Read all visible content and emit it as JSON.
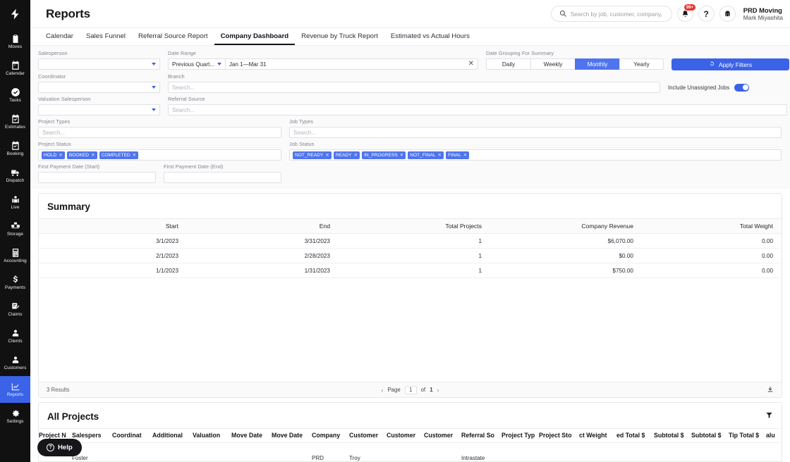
{
  "sidebar": {
    "logo_icon": "bolt-logo-icon",
    "items": [
      {
        "label": "Moves",
        "icon": "clipboard-icon",
        "active": false
      },
      {
        "label": "Calendar",
        "icon": "calendar-icon",
        "active": false
      },
      {
        "label": "Tasks",
        "icon": "check-circle-icon",
        "active": false
      },
      {
        "label": "Estimates",
        "icon": "calendar-check-icon",
        "active": false
      },
      {
        "label": "Booking",
        "icon": "calendar-book-icon",
        "active": false
      },
      {
        "label": "Dispatch",
        "icon": "truck-icon",
        "active": false
      },
      {
        "label": "Live",
        "icon": "live-person-icon",
        "active": false
      },
      {
        "label": "Storage",
        "icon": "boxes-icon",
        "active": false
      },
      {
        "label": "Accounting",
        "icon": "calculator-icon",
        "active": false
      },
      {
        "label": "Payments",
        "icon": "dollar-icon",
        "active": false
      },
      {
        "label": "Claims",
        "icon": "claim-doc-icon",
        "active": false
      },
      {
        "label": "Clients",
        "icon": "person-icon",
        "active": false
      },
      {
        "label": "Customers",
        "icon": "person-icon",
        "active": false
      },
      {
        "label": "Reports",
        "icon": "chart-icon",
        "active": true
      },
      {
        "label": "Settings",
        "icon": "gear-icon",
        "active": false
      }
    ]
  },
  "header": {
    "title": "Reports",
    "search": {
      "placeholder": "Search by job, customer, company, etc...",
      "icon": "search-icon"
    },
    "notifications": {
      "icon": "bell-icon",
      "badge": "99+"
    },
    "help": {
      "icon": "question-mark-icon",
      "label": "?"
    },
    "account": {
      "icon": "avatar-icon"
    },
    "user": {
      "org": "PRD Moving",
      "name": "Mark Miyashita"
    }
  },
  "tabs": [
    {
      "label": "Calendar",
      "active": false
    },
    {
      "label": "Sales Funnel",
      "active": false
    },
    {
      "label": "Referral Source Report",
      "active": false
    },
    {
      "label": "Company Dashboard",
      "active": true
    },
    {
      "label": "Revenue by Truck Report",
      "active": false
    },
    {
      "label": "Estimated vs Actual Hours",
      "active": false
    }
  ],
  "filters": {
    "salesperson": {
      "label": "Salesperson",
      "value": ""
    },
    "coordinator": {
      "label": "Coordinator",
      "value": ""
    },
    "valuation_salesperson": {
      "label": "Valuation Salesperson",
      "value": ""
    },
    "date_range": {
      "label": "Date Range",
      "preset": "Previous Quart...",
      "value": "Jan 1—Mar 31",
      "clear_icon": "close-icon"
    },
    "branch": {
      "label": "Branch",
      "placeholder": "Search..."
    },
    "referral_source": {
      "label": "Referral Source",
      "placeholder": "Search..."
    },
    "project_types": {
      "label": "Project Types",
      "placeholder": "Search..."
    },
    "job_types": {
      "label": "Job Types",
      "placeholder": "Search..."
    },
    "project_status": {
      "label": "Project Status",
      "chips": [
        "HOLD",
        "BOOKED",
        "COMPLETED"
      ]
    },
    "job_status": {
      "label": "Job Status",
      "chips": [
        "NOT_READY",
        "READY",
        "IN_PROGRESS",
        "NOT_FINAL",
        "FINAL"
      ]
    },
    "first_payment_start": {
      "label": "First Payment Date (Start)",
      "value": ""
    },
    "first_payment_end": {
      "label": "First Payment Date (End)",
      "value": ""
    },
    "date_grouping": {
      "label": "Date Grouping For Summary",
      "options": [
        "Daily",
        "Weekly",
        "Monthly",
        "Yearly"
      ],
      "selected": "Monthly"
    },
    "apply_button": {
      "label": "Apply Filters",
      "icon": "refresh-icon"
    },
    "include_unassigned": {
      "label": "Include Unassigned Jobs",
      "on": true
    }
  },
  "summary": {
    "title": "Summary",
    "columns": [
      "Start",
      "End",
      "Total Projects",
      "Company Revenue",
      "Total Weight"
    ],
    "rows": [
      [
        "3/1/2023",
        "3/31/2023",
        "1",
        "$6,070.00",
        "0.00"
      ],
      [
        "2/1/2023",
        "2/28/2023",
        "1",
        "$0.00",
        "0.00"
      ],
      [
        "1/1/2023",
        "1/31/2023",
        "1",
        "$750.00",
        "0.00"
      ]
    ],
    "footer": {
      "results": "3 Results",
      "page_label": "Page",
      "page_number": "1",
      "of_label": "of",
      "total_pages": "1",
      "prev_icon": "chevron-left-icon",
      "next_icon": "chevron-right-icon",
      "download_icon": "download-icon"
    }
  },
  "projects": {
    "title": "All Projects",
    "filter_icon": "funnel-icon",
    "columns": [
      "Project N",
      "Salespers",
      "Coordinat",
      "Additional",
      "Valuation",
      "Move Date",
      "Move Date",
      "Company",
      "Customer",
      "Customer",
      "Customer",
      "Referral So",
      "Project Typ",
      "Project Sto",
      "ct Weight",
      "ed Total $",
      "Subtotal $",
      "Subtotal $",
      "Tip Total $",
      "alu"
    ],
    "row": [
      "",
      "Foster",
      "",
      "",
      "",
      "",
      "",
      "PRD",
      "Troy",
      "",
      "",
      "Intrastate",
      "",
      "",
      "",
      "",
      "",
      "",
      "",
      ""
    ]
  },
  "help": {
    "label": "Help",
    "icon": "question-circle-icon",
    "mark": "?"
  },
  "colors": {
    "accent": "#3b63e8",
    "chip": "#4f74ed",
    "sidebar_bg": "#111112",
    "badge_red": "#e8342c",
    "panel_bg": "#fafafb"
  }
}
